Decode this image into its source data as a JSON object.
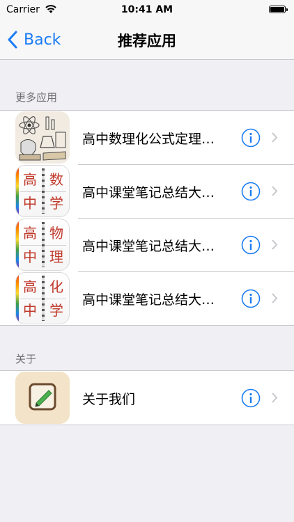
{
  "status_bar": {
    "carrier": "Carrier",
    "time": "10:41 AM"
  },
  "nav": {
    "back_label": "Back",
    "title": "推荐应用"
  },
  "sections": {
    "more_apps": "更多应用",
    "about": "关于"
  },
  "apps": [
    {
      "title": "高中数理化公式定理…",
      "icon": "science-sketch-icon"
    },
    {
      "title": "高中课堂笔记总结大…",
      "icon": "notebook-math-icon",
      "chars": [
        "高",
        "数",
        "中",
        "学"
      ]
    },
    {
      "title": "高中课堂笔记总结大…",
      "icon": "notebook-physics-icon",
      "chars": [
        "高",
        "物",
        "中",
        "理"
      ]
    },
    {
      "title": "高中课堂笔记总结大…",
      "icon": "notebook-chemistry-icon",
      "chars": [
        "高",
        "化",
        "中",
        "学"
      ]
    }
  ],
  "about_row": {
    "title": "关于我们",
    "icon": "pencil-note-icon"
  },
  "colors": {
    "accent": "#1a7cf3",
    "background": "#efeff4",
    "separator": "#c8c7cc"
  }
}
